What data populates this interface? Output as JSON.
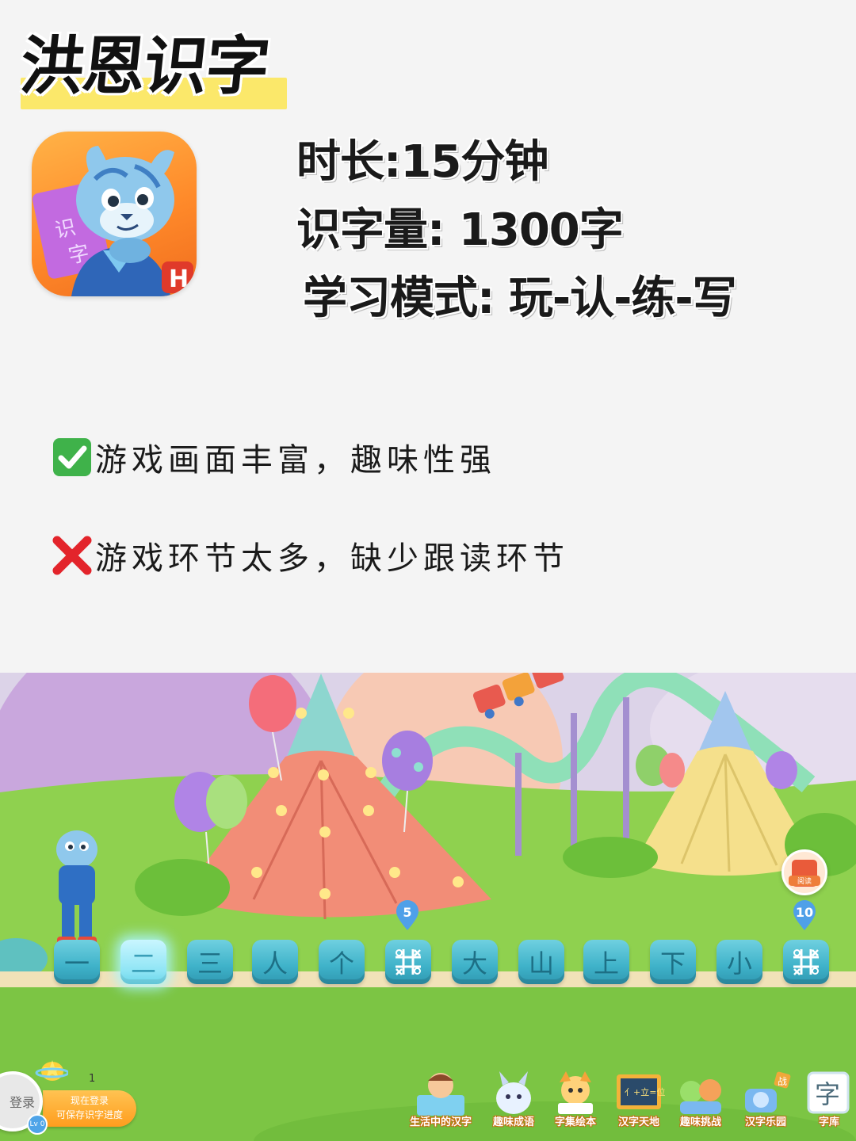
{
  "header": {
    "title": "洪恩识字"
  },
  "app": {
    "icon": "hong-en-tiger-app-icon"
  },
  "stats": {
    "duration": "时长:15分钟",
    "word_count": "识字量: 1300字",
    "mode": "学习模式: 玩-认-练-写"
  },
  "review": {
    "pro": {
      "icon": "check-mark-icon",
      "text": "游戏画面丰富，趣味性强"
    },
    "con": {
      "icon": "cross-mark-icon",
      "text": "游戏环节太多，缺少跟读环节"
    }
  },
  "game": {
    "path_tiles": [
      "一",
      "二",
      "三",
      "人",
      "个",
      "游戏",
      "大",
      "山",
      "上",
      "下",
      "小",
      "游戏"
    ],
    "active_tile_index": 1,
    "markers": [
      "5",
      "10"
    ],
    "login": {
      "avatar_text": "登录",
      "level": "Lv 0",
      "star_count": "1",
      "line1": "现在登录",
      "line2": "可保存识字进度"
    },
    "reading_button": "阅读",
    "dock": [
      {
        "label": "生活中的汉字",
        "icon": "life-hanzi-icon"
      },
      {
        "label": "趣味成语",
        "icon": "idiom-icon"
      },
      {
        "label": "字集绘本",
        "icon": "picture-book-icon"
      },
      {
        "label": "汉字天地",
        "icon": "blackboard-icon"
      },
      {
        "label": "趣味挑战",
        "icon": "challenge-icon"
      },
      {
        "label": "汉字乐园",
        "icon": "hanzi-park-icon"
      },
      {
        "label": "字库",
        "icon": "word-bank-icon"
      }
    ]
  },
  "colors": {
    "title_highlight": "#fbe86a",
    "tile": "#3fb2c9",
    "grass": "#8fd14f",
    "banner_orange": "#ff9d1e"
  }
}
